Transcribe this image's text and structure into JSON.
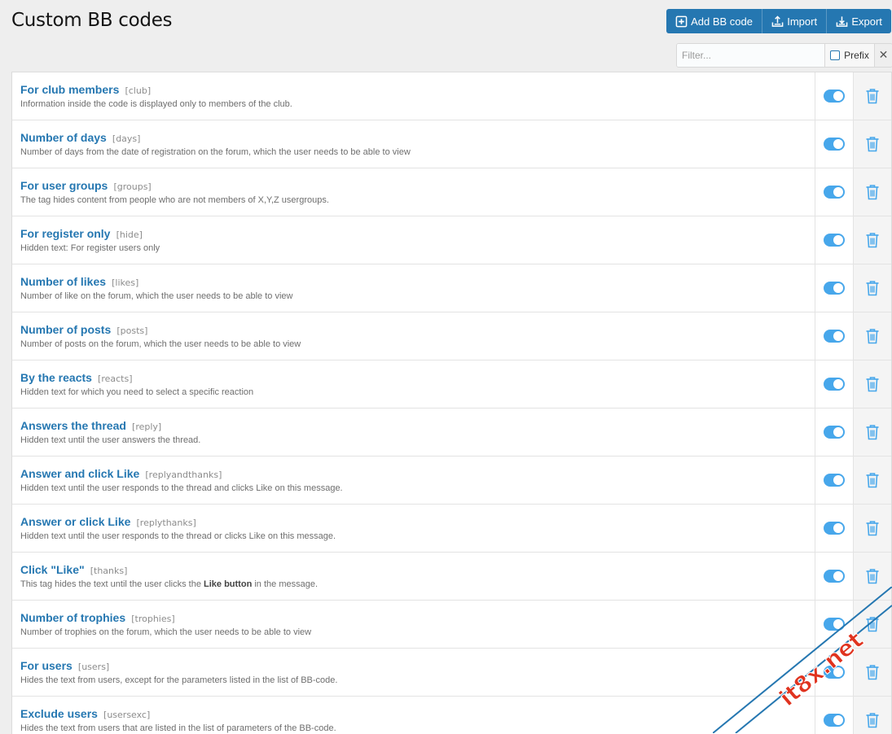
{
  "page": {
    "title": "Custom BB codes"
  },
  "actions": {
    "add_label": "Add BB code",
    "import_label": "Import",
    "export_label": "Export"
  },
  "filter": {
    "placeholder": "Filter...",
    "value": "",
    "prefix_label": "Prefix",
    "clear_glyph": "✕"
  },
  "colors": {
    "accent": "#2577b1",
    "toggle_on": "#47a7eb"
  },
  "items": [
    {
      "title": "For club members",
      "tag": "[club]",
      "desc": "Information inside the code is displayed only to members of the club."
    },
    {
      "title": "Number of days",
      "tag": "[days]",
      "desc": "Number of days from the date of registration on the forum, which the user needs to be able to view"
    },
    {
      "title": "For user groups",
      "tag": "[groups]",
      "desc": "The tag hides content from people who are not members of X,Y,Z usergroups."
    },
    {
      "title": "For register only",
      "tag": "[hide]",
      "desc": "Hidden text: For register users only"
    },
    {
      "title": "Number of likes",
      "tag": "[likes]",
      "desc": "Number of like on the forum, which the user needs to be able to view"
    },
    {
      "title": "Number of posts",
      "tag": "[posts]",
      "desc": "Number of posts on the forum, which the user needs to be able to view"
    },
    {
      "title": "By the reacts",
      "tag": "[reacts]",
      "desc": "Hidden text for which you need to select a specific reaction"
    },
    {
      "title": "Answers the thread",
      "tag": "[reply]",
      "desc": "Hidden text until the user answers the thread."
    },
    {
      "title": "Answer and click Like",
      "tag": "[replyandthanks]",
      "desc": "Hidden text until the user responds to the thread and clicks Like on this message."
    },
    {
      "title": "Answer or click Like",
      "tag": "[replythanks]",
      "desc": "Hidden text until the user responds to the thread or clicks Like on this message."
    },
    {
      "title": "Click \"Like\"",
      "tag": "[thanks]",
      "desc_pre": "This tag hides the text until the user clicks the ",
      "desc_bold": "Like button",
      "desc_post": " in the message."
    },
    {
      "title": "Number of trophies",
      "tag": "[trophies]",
      "desc": "Number of trophies on the forum, which the user needs to be able to view"
    },
    {
      "title": "For users",
      "tag": "[users]",
      "desc": "Hides the text from users, except for the parameters listed in the list of BB-code."
    },
    {
      "title": "Exclude users",
      "tag": "[usersexc]",
      "desc": "Hides the text from users that are listed in the list of parameters of the BB-code."
    }
  ],
  "watermark": {
    "text": "it8x.net"
  }
}
